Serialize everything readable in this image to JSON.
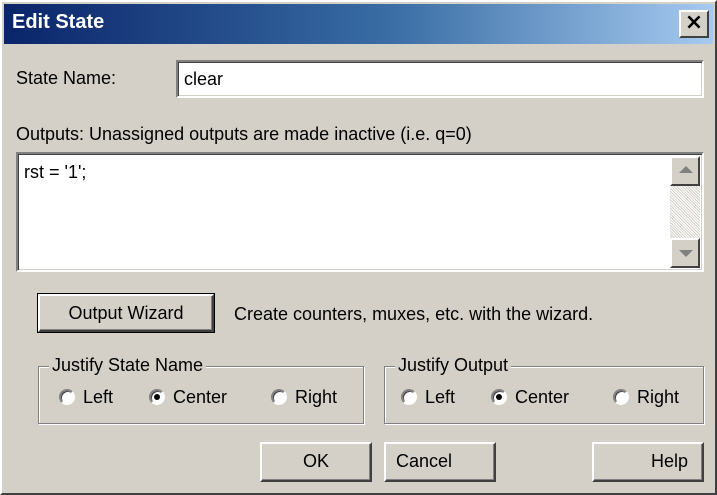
{
  "window": {
    "title": "Edit State",
    "close_glyph": "×"
  },
  "state_name": {
    "label": "State Name:",
    "value": "clear"
  },
  "outputs": {
    "label": "Outputs:   Unassigned outputs are made inactive (i.e. q=0)",
    "value": "rst = '1';"
  },
  "wizard": {
    "button_label": "Output Wizard",
    "hint": "Create counters, muxes, etc. with the wizard."
  },
  "justify_state_name": {
    "legend": "Justify State Name",
    "options": [
      "Left",
      "Center",
      "Right"
    ],
    "selected": "Center"
  },
  "justify_output": {
    "legend": "Justify Output",
    "options": [
      "Left",
      "Center",
      "Right"
    ],
    "selected": "Center"
  },
  "buttons": {
    "ok": "OK",
    "cancel": "Cancel",
    "help": "Help"
  },
  "colors": {
    "titlebar_start": "#0a246a",
    "titlebar_end": "#a6caf0",
    "face": "#d4d0c8"
  },
  "icons": {
    "close": "close-icon",
    "scroll_up": "scroll-up-arrow-icon",
    "scroll_down": "scroll-down-arrow-icon"
  }
}
